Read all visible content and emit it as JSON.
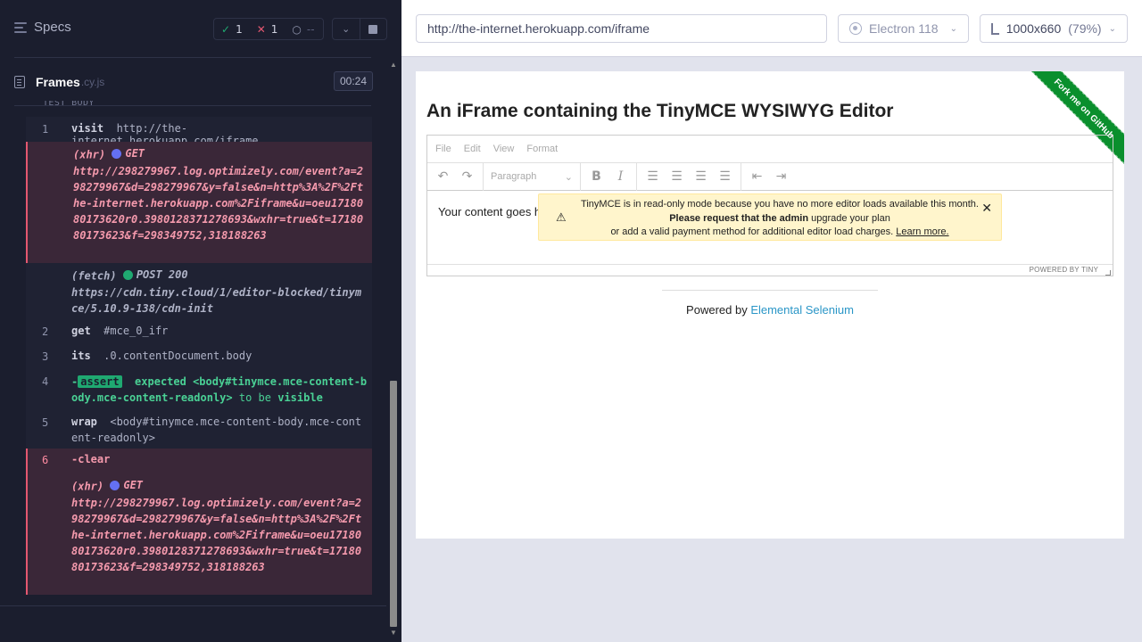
{
  "reporter": {
    "specs_label": "Specs",
    "stats": {
      "passed": "1",
      "failed": "1",
      "pending": "--"
    },
    "controls": {
      "expand_icon": "chevron-down-icon",
      "stop_icon": "stop-icon"
    },
    "file": {
      "name": "Frames",
      "ext": ".cy.js",
      "duration": "00:24"
    },
    "section_label": "TEST BODY",
    "commands": [
      {
        "num": "1",
        "name": "visit",
        "message": "http://the-internet.herokuapp.com/iframe"
      },
      {
        "type": "(xhr)",
        "method": "GET",
        "url": "http://298279967.log.optimizely.com/event?a=298279967&d=298279967&y=false&n=http%3A%2F%2Fthe-internet.herokuapp.com%2Fiframe&u=oeu1718080173620r0.3980128371278693&wxhr=true&t=1718080173623&f=298349752,318188263"
      },
      {
        "type": "(fetch)",
        "method": "POST 200",
        "url": "https://cdn.tiny.cloud/1/editor-blocked/tinymce/5.10.9-138/cdn-init"
      },
      {
        "num": "2",
        "name": "get",
        "message": "#mce_0_ifr"
      },
      {
        "num": "3",
        "name": "its",
        "message": ".0.contentDocument.body"
      },
      {
        "num": "4",
        "name": "-assert",
        "expected": "expected",
        "subject": "<body#tinymce.mce-content-body.mce-content-readonly>",
        "to_be": "to be",
        "visible": "visible"
      },
      {
        "num": "5",
        "name": "wrap",
        "message": "<body#tinymce.mce-content-body.mce-content-readonly>"
      },
      {
        "num": "6",
        "name": "-clear"
      },
      {
        "type": "(xhr)",
        "method": "GET",
        "url": "http://298279967.log.optimizely.com/event?a=298279967&d=298279967&y=false&n=http%3A%2F%2Fthe-internet.herokuapp.com%2Fiframe&u=oeu1718080173620r0.3980128371278693&wxhr=true&t=1718080173623&f=298349752,318188263"
      }
    ]
  },
  "aut": {
    "url": "http://the-internet.herokuapp.com/iframe",
    "browser": "Electron 118",
    "viewport": "1000x660",
    "zoom": "(79%)",
    "page": {
      "heading": "An iFrame containing the TinyMCE WYSIWYG Editor",
      "ribbon": "Fork me on GitHub",
      "menu": [
        "File",
        "Edit",
        "View",
        "Format"
      ],
      "paragraph_select": "Paragraph",
      "content": "Your content goes here.",
      "powered_tiny": "POWERED BY TINY",
      "notice": {
        "line1": "TinyMCE is in read-only mode because you have no more editor loads available this month.",
        "line2_bold": "Please request that the admin",
        "line2_rest": " upgrade your plan",
        "line3": "or add a valid payment method for additional editor load charges. ",
        "link": "Learn more."
      },
      "footer_prefix": "Powered by ",
      "footer_link": "Elemental Selenium"
    }
  }
}
